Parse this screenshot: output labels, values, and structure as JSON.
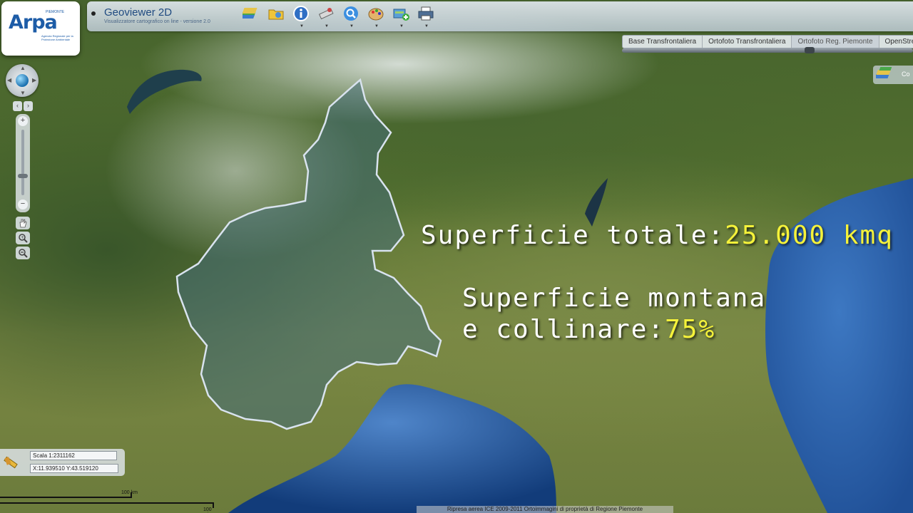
{
  "app": {
    "title": "Geoviewer 2D",
    "subtitle": "Visualizzatore cartografico on line - versione 2.0"
  },
  "logo": {
    "text": "Arpa",
    "tagline": "PIEMONTE",
    "subtext": "Agenzia Regionale per la Protezione Ambientale"
  },
  "toolbar": {
    "icons": [
      {
        "name": "layers-icon"
      },
      {
        "name": "folder-icon"
      },
      {
        "name": "info-icon"
      },
      {
        "name": "measure-icon"
      },
      {
        "name": "search-icon"
      },
      {
        "name": "palette-icon"
      },
      {
        "name": "add-layer-icon"
      },
      {
        "name": "print-icon"
      }
    ]
  },
  "basemaps": {
    "tabs": [
      {
        "label": "Base Transfrontaliera"
      },
      {
        "label": "Ortofoto Transfrontaliera"
      },
      {
        "label": "Ortofoto Reg. Piemonte"
      },
      {
        "label": "OpenStree"
      }
    ],
    "active_index": 2,
    "legend_label": "Co"
  },
  "overlay": {
    "line1_label": "Superficie totale:",
    "line1_value": "25.000 kmq",
    "line2_label": "Superficie montana",
    "line3_label": "e collinare:",
    "line3_value": "75%"
  },
  "status": {
    "scale": "Scala 1:2311162",
    "coords": "X:11.939510  Y:43.519120"
  },
  "scalebar": {
    "top_label": "100 km",
    "bottom_label": "100 mi"
  },
  "attribution": "Ripresa aerea ICE 2009-2011 Ortoimmagini di proprietà di Regione Piemonte",
  "colors": {
    "highlight": "#f5f23a",
    "region_outline": "#d9e3ef",
    "sea": "#2f64b0"
  }
}
